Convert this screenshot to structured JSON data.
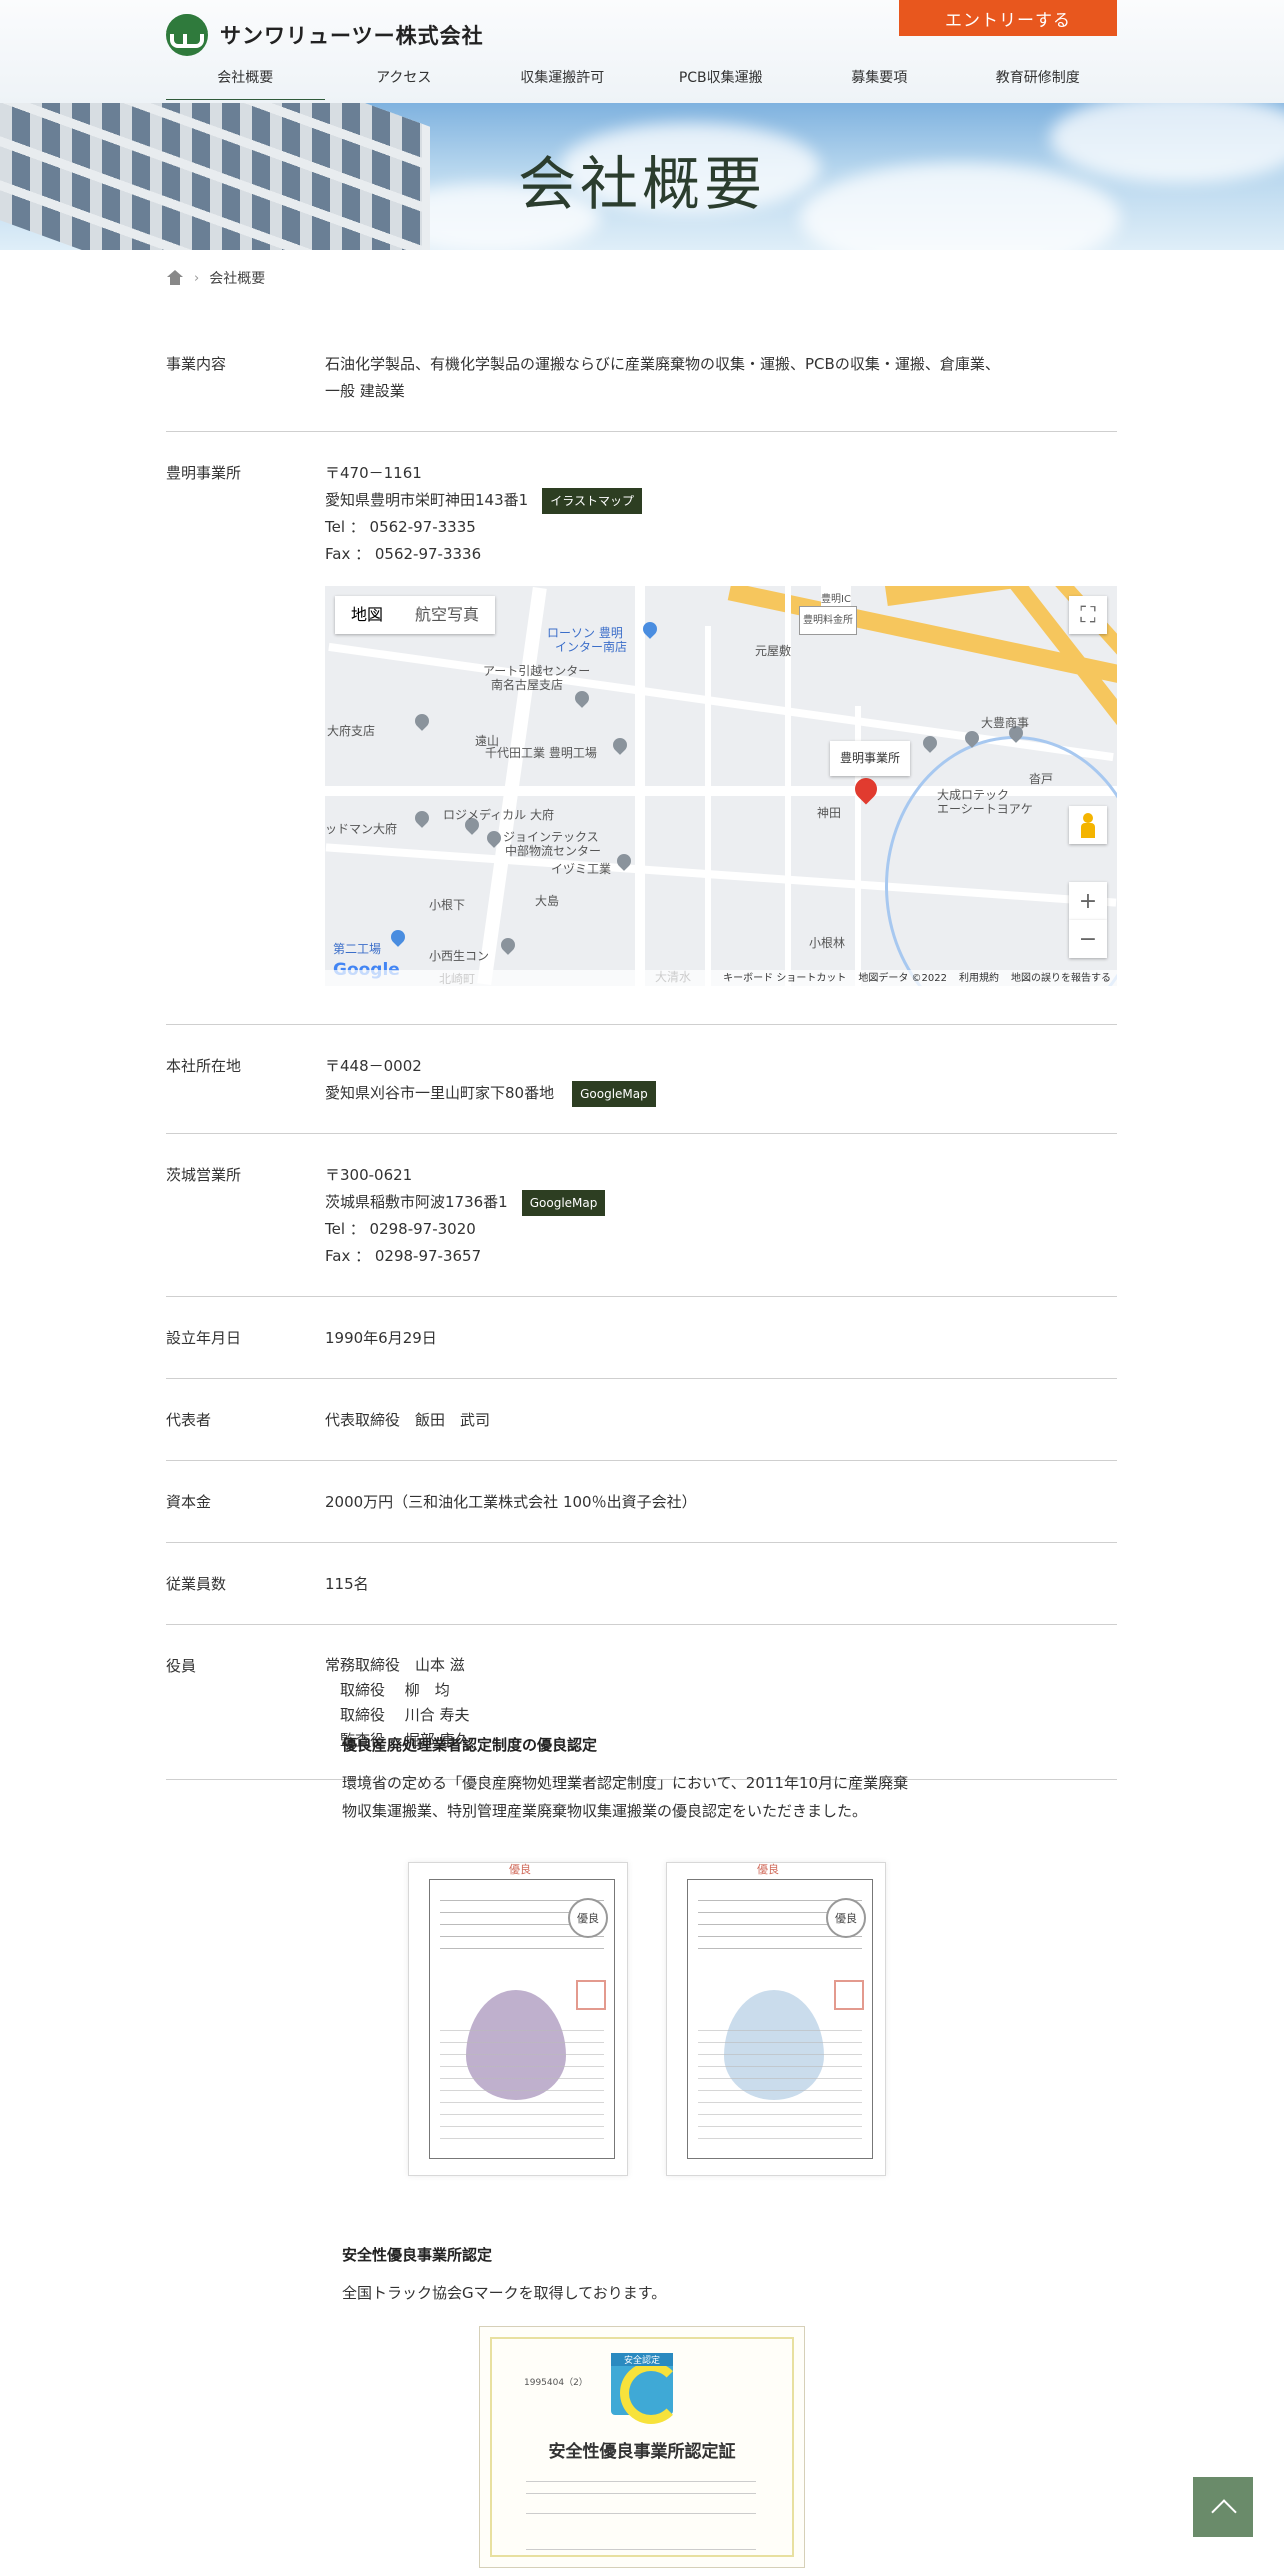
{
  "header": {
    "logo_text": "サンワリューツー株式会社",
    "entry_label": "エントリーする",
    "nav": [
      "会社概要",
      "アクセス",
      "収集運搬許可",
      "PCB収集運搬",
      "募集要項",
      "教育研修制度"
    ]
  },
  "hero": {
    "title": "会社概要"
  },
  "breadcrumb": {
    "current": "会社概要"
  },
  "rows": {
    "business": {
      "label": "事業内容",
      "line1": "石油化学製品、有機化学製品の運搬ならびに産業廃棄物の収集・運搬、PCBの収集・運搬、倉庫業、",
      "line2": "一般 建設業"
    },
    "toyoake": {
      "label": "豊明事業所",
      "zip": "〒470－1161",
      "address": "愛知県豊明市栄町神田143番1",
      "badge": "イラストマップ",
      "tel": "Tel ： 0562-97-3335",
      "fax": "Fax ： 0562-97-3336"
    },
    "hq": {
      "label": "本社所在地",
      "zip": "〒448－0002",
      "address": "愛知県刈谷市一里山町家下80番地",
      "badge": "GoogleMap"
    },
    "ibaraki": {
      "label": "茨城営業所",
      "zip": "〒300-0621",
      "address": "茨城県稲敷市阿波1736番1",
      "badge": "GoogleMap",
      "tel": "Tel ： 0298-97-3020",
      "fax": "Fax ： 0298-97-3657"
    },
    "founded": {
      "label": "設立年月日",
      "value": "1990年6月29日"
    },
    "rep": {
      "label": "代表者",
      "value": "代表取締役　飯田　武司"
    },
    "capital": {
      "label": "資本金",
      "value": "2000万円（三和油化工業株式会社 100％出資子会社）"
    },
    "employees": {
      "label": "従業員数",
      "value": "115名"
    },
    "officers": {
      "label": "役員",
      "lines": [
        "常務取締役　山本 滋",
        "　取締役　 柳　均",
        "　取締役　 川合 寿夫",
        "　監査役　 堀部 康久"
      ]
    }
  },
  "map": {
    "type_map": "地図",
    "type_sat": "航空写真",
    "bubble": "豊明事業所",
    "labels": [
      "ローソン 豊明",
      "インター南店",
      "アート引越センター",
      "南名古屋支店",
      "元屋敷",
      "豊明IC",
      "豊明料金所",
      "千代田工業 豊明工場",
      "ロジメディカル 大府",
      "ジョインテックス",
      "中部物流センター",
      "イヅミ工業",
      "大豊商事",
      "大成ロテック",
      "エーシートヨアケ",
      "沓戸",
      "神田",
      "大島",
      "小根下",
      "小根林",
      "大清水",
      "北崎町",
      "小西生コン",
      "第二工場",
      "大府支店",
      "ッドマン大府",
      "遠山"
    ],
    "footer": [
      "キーボード ショートカット",
      "地図データ ©2022",
      "利用規約",
      "地図の誤りを報告する"
    ],
    "google": "Google"
  },
  "awards": {
    "a1_title": "優良産廃処理業者認定制度の優良認定",
    "a1_text1": "環境省の定める「優良産廃物処理業者認定制度」において、2011年10月に産業廃棄",
    "a1_text2": "物収集運搬業、特別管理産業廃棄物収集運搬業の優良認定をいただきました。",
    "a2_title": "安全性優良事業所認定",
    "a2_text": "全国トラック協会Gマークを取得しております。",
    "g_title": "安全性優良事業所認定証",
    "g_badge": "安全認定",
    "g_num": "1995404（2）"
  }
}
